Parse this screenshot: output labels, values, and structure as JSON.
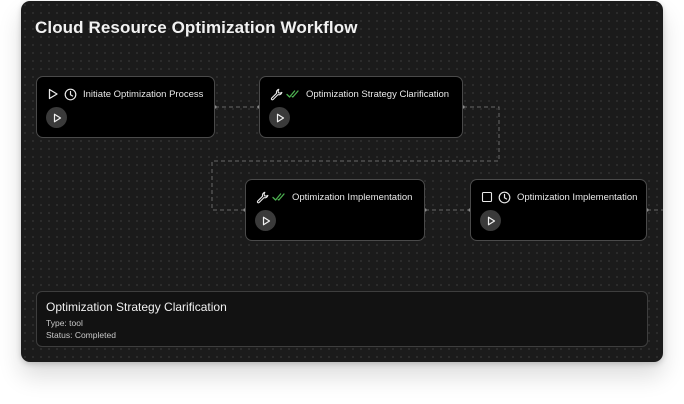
{
  "workflow": {
    "title": "Cloud Resource Optimization Workflow"
  },
  "nodes": [
    {
      "label": "Initiate Optimization Process",
      "type_icon": "play-icon",
      "status_icon": "clock-icon",
      "action": "run-icon"
    },
    {
      "label": "Optimization Strategy Clarification",
      "type_icon": "wrench-icon",
      "status_icon": "double-check-icon",
      "action": "run-icon"
    },
    {
      "label": "Optimization Implementation",
      "type_icon": "wrench-icon",
      "status_icon": "double-check-icon",
      "action": "run-icon"
    },
    {
      "label": "Optimization Implementation",
      "type_icon": "checkbox-icon",
      "status_icon": "clock-icon",
      "action": "run-icon"
    }
  ],
  "details": {
    "title": "Optimization Strategy Clarification",
    "type_line": "Type: tool",
    "status_line": "Status: Completed"
  },
  "colors": {
    "panel_background": "#1b1b1b",
    "node_background": "#000000",
    "completed_check": "#4caf50",
    "edge": "#6a6a6a"
  }
}
